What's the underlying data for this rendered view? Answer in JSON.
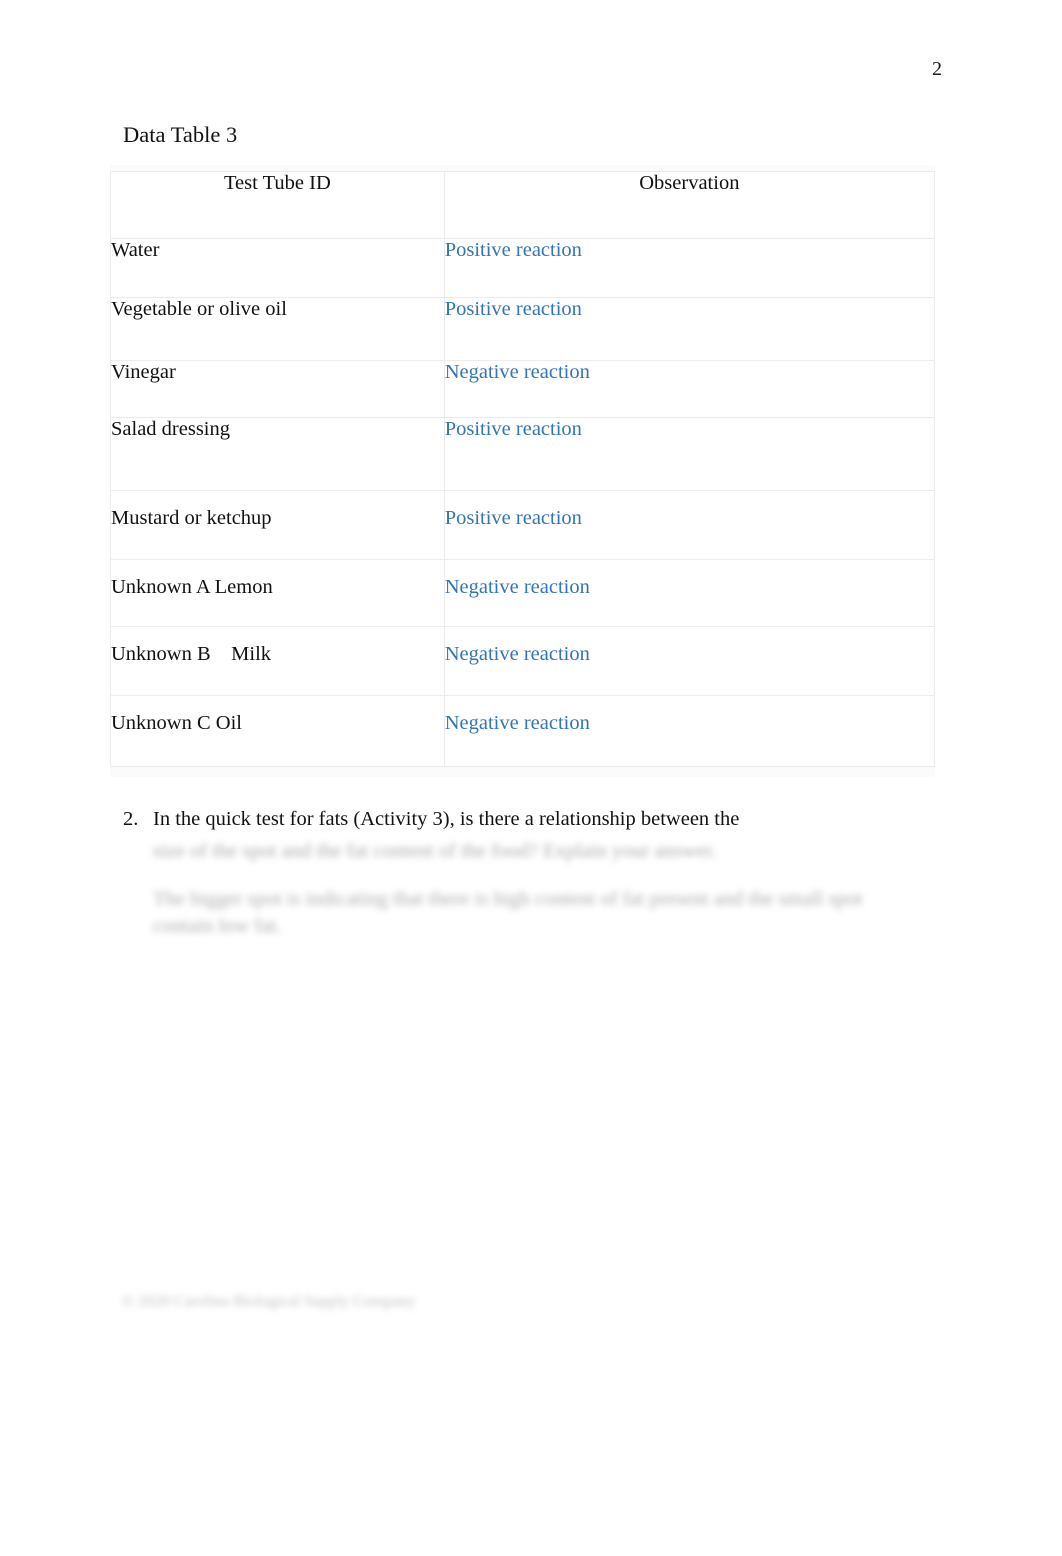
{
  "page": {
    "number": "2"
  },
  "table": {
    "title": "Data Table 3",
    "columns": [
      {
        "key": "test_tube_id",
        "label": "Test Tube ID"
      },
      {
        "key": "observation",
        "label": "Observation"
      }
    ],
    "observation_color": "#3275b4",
    "border_color": "#ececec",
    "rows": [
      {
        "test_tube_id": "Water",
        "observation": "Positive reaction"
      },
      {
        "test_tube_id": "Vegetable or olive oil",
        "observation": "Positive reaction"
      },
      {
        "test_tube_id": "Vinegar",
        "observation": "Negative reaction"
      },
      {
        "test_tube_id": "Salad dressing",
        "observation": "Positive reaction"
      },
      {
        "test_tube_id": "Mustard or ketchup",
        "observation": "Positive reaction"
      },
      {
        "test_tube_id": "Unknown A Lemon",
        "observation": "Negative reaction"
      },
      {
        "test_tube_id": "Unknown B    Milk",
        "observation": "Negative reaction"
      },
      {
        "test_tube_id": "Unknown C Oil",
        "observation": "Negative reaction"
      }
    ]
  },
  "question": {
    "number": "2.",
    "text": "In the quick test for fats (Activity 3), is there a relationship between the",
    "text_continued_blurred": "size of the spot and the fat content of the food? Explain your answer.",
    "answer_blurred": "The bigger spot is indicating that there is high content of fat present and the small spot contain low fat."
  },
  "footer": {
    "text_blurred": "© 2020 Carolina Biological Supply Company"
  }
}
